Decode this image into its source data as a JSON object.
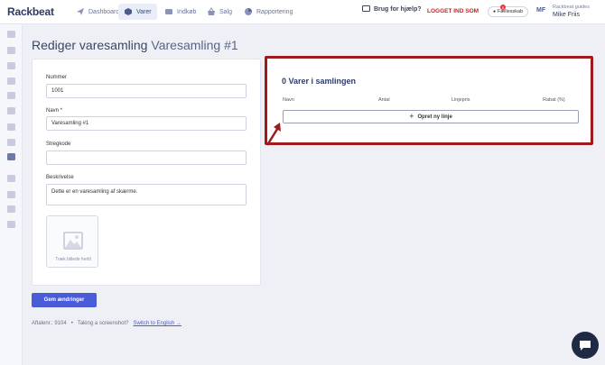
{
  "app": {
    "logo": "Rackbeat"
  },
  "nav": {
    "items": [
      {
        "label": "Dashboard",
        "icon": "send-icon"
      },
      {
        "label": "Varer",
        "icon": "box-icon"
      },
      {
        "label": "Indkøb",
        "icon": "cart-icon"
      },
      {
        "label": "Salg",
        "icon": "basket-icon"
      },
      {
        "label": "Rapportering",
        "icon": "pie-chart-icon"
      }
    ],
    "active": "Varer"
  },
  "header": {
    "help": "Brug for hjælp?",
    "logged_in_as": "LOGGET IND SOM",
    "chat_pill": "Fællesskab",
    "chat_badge": "5",
    "avatar_initials": "MF",
    "user_org": "Rackbeat guides",
    "user_name": "Mike Friis"
  },
  "page": {
    "title": "Rediger varesamling",
    "subtitle": "Varesamling #1"
  },
  "form": {
    "number_label": "Nummer",
    "number_value": "1001",
    "name_label": "Navn *",
    "name_value": "Varesamling #1",
    "barcode_label": "Stregkode",
    "barcode_value": "",
    "description_label": "Beskrivelse",
    "description_value": "Dette er en varesamling af skærme.",
    "image_drop_label": "Træk billede hertil",
    "save_label": "Gem ændringer"
  },
  "footer": {
    "order_no": "Aftalenr.: 9104",
    "separator": "•",
    "screenshot_prompt": "Taking a screenshot?",
    "switch_link": "Switch to English →"
  },
  "collection": {
    "title": "0 Varer i samlingen",
    "columns": [
      "Navn",
      "Antal",
      "Linjepris",
      "Rabat (%)"
    ],
    "add_line_label": "Opret ny linje"
  },
  "colors": {
    "accent": "#4a5bd8",
    "highlight_border": "#a11a1a",
    "logged_in_red": "#cc1f1f"
  }
}
